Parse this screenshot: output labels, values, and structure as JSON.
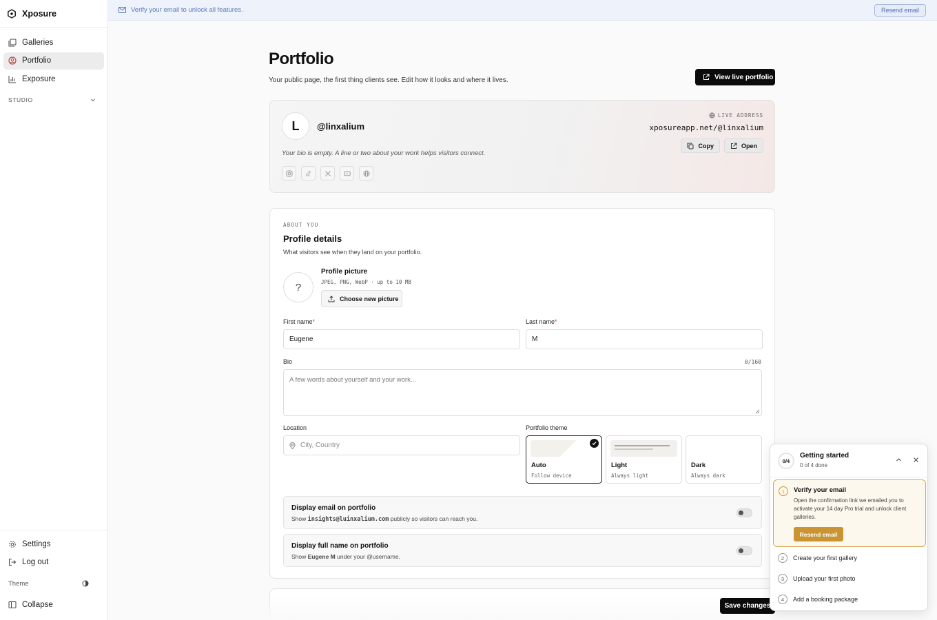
{
  "app": {
    "name": "Xposure"
  },
  "sidebar": {
    "items": [
      {
        "label": "Galleries",
        "icon": "galleries-icon"
      },
      {
        "label": "Portfolio",
        "icon": "portfolio-icon",
        "active": true
      },
      {
        "label": "Exposure",
        "icon": "chart-icon"
      }
    ],
    "section": "STUDIO",
    "bottom": {
      "settings": "Settings",
      "logout": "Log out",
      "theme": "Theme",
      "collapse": "Collapse"
    }
  },
  "banner": {
    "text": "Verify your email to unlock all features.",
    "button": "Resend email"
  },
  "header": {
    "title": "Portfolio",
    "subtitle": "Your public page, the first thing clients see. Edit how it looks and where it lives.",
    "view_live": "View live portfolio"
  },
  "hero": {
    "initial": "L",
    "handle": "@linxalium",
    "bio_empty": "Your bio is empty. A line or two about your work helps visitors connect.",
    "live_label": "LIVE ADDRESS",
    "live_url": "xposureapp.net/@linxalium",
    "copy": "Copy",
    "open": "Open",
    "socials": [
      "instagram-icon",
      "tiktok-icon",
      "x-icon",
      "youtube-icon",
      "globe-icon"
    ]
  },
  "profile": {
    "eyebrow": "ABOUT YOU",
    "title": "Profile details",
    "description": "What visitors see when they land on your portfolio.",
    "picture_label": "Profile picture",
    "picture_hint": "JPEG, PNG, WebP · up to 10 MB",
    "picture_placeholder": "?",
    "choose_button": "Choose new picture",
    "first_name_label": "First name",
    "first_name": "Eugene",
    "last_name_label": "Last name",
    "last_name": "M",
    "required_mark": "*",
    "bio_label": "Bio",
    "bio_counter": "0/160",
    "bio_placeholder": "A few words about yourself and your work...",
    "location_label": "Location",
    "location_placeholder": "City, Country",
    "theme_label": "Portfolio theme",
    "themes": [
      {
        "name": "Auto",
        "sub": "Follow device",
        "selected": true
      },
      {
        "name": "Light",
        "sub": "Always light",
        "selected": false
      },
      {
        "name": "Dark",
        "sub": "Always dark",
        "selected": false
      }
    ],
    "toggles": [
      {
        "title": "Display email on portfolio",
        "pre": "Show ",
        "strong": "insights@luinxalium.com",
        "post": " publicly so visitors can reach you.",
        "on": false
      },
      {
        "title": "Display full name on portfolio",
        "pre": "Show ",
        "strong": "Eugene M",
        "post": " under your @username.",
        "on": false
      }
    ]
  },
  "save_button": "Save changes",
  "getting_started": {
    "progress": "0/4",
    "title": "Getting started",
    "subtitle": "0 of 4 done",
    "active_step": {
      "number": "1",
      "title": "Verify your email",
      "description": "Open the confirmation link we emailed you to activate your 14 day Pro trial and unlock client galleries.",
      "button": "Resend email"
    },
    "steps": [
      {
        "number": "2",
        "label": "Create your first gallery"
      },
      {
        "number": "3",
        "label": "Upload your first photo"
      },
      {
        "number": "4",
        "label": "Add a booking package"
      }
    ]
  }
}
